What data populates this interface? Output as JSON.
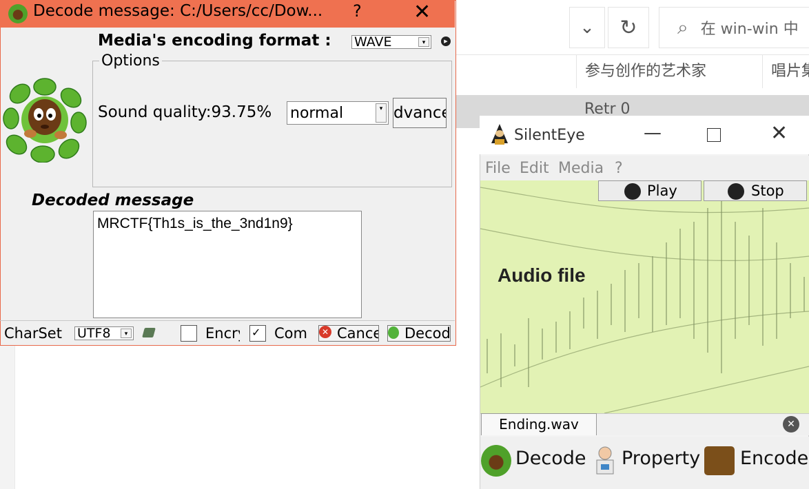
{
  "background_explorer": {
    "search_placeholder": "在 win-win 中",
    "column_artist": "参与创作的艺术家",
    "column_album": "唱片集",
    "row_fragment": "Retr  0"
  },
  "decode_dialog": {
    "title": "Decode message: C:/Users/cc/Dow...",
    "help_label": "?",
    "close_label": "✕",
    "encoding_format_label": "Media's encoding format :",
    "encoding_format_value": "WAVE",
    "options_group_label": "Options",
    "sound_quality_label": "Sound quality:",
    "sound_quality_value": "93.75%",
    "quality_mode_value": "normal",
    "advanced_button_label": "dvance",
    "decoded_message_label": "Decoded message",
    "decoded_message_text": "MRCTF{Th1s_is_the_3nd1n9}",
    "charset_label": "CharSet",
    "charset_value": "UTF8",
    "encrypt_label": "Encry",
    "compress_label": "Com",
    "cancel_button_label": "Cance",
    "decode_button_label": "Decod"
  },
  "silenteye": {
    "title": "SilentEye",
    "menu": [
      "File",
      "Edit",
      "Media",
      "?"
    ],
    "play_label": "Play",
    "stop_label": "Stop",
    "visual_label": "Audio file",
    "file_tab_label": "Ending.wav",
    "toolbar": {
      "decode_label": "Decode",
      "property_label": "Property",
      "encode_label": "Encode"
    }
  },
  "colors": {
    "decode_titlebar": "#ef7150",
    "visual_background": "#e2f2b4"
  }
}
